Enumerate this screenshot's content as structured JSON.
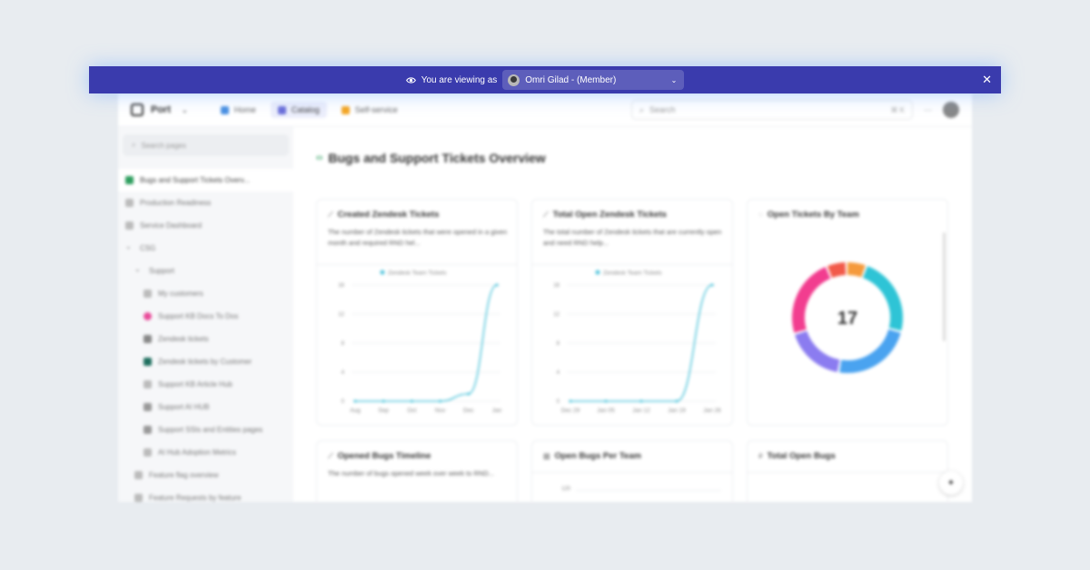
{
  "viewing_bar": {
    "label": "You are viewing as",
    "member": "Omri Gilad - (Member)"
  },
  "topnav": {
    "brand": "Port",
    "tabs": [
      {
        "label": "Home",
        "color": "#4a90e2"
      },
      {
        "label": "Catalog",
        "color": "#6b6fd9"
      },
      {
        "label": "Self-service",
        "color": "#f5a623"
      }
    ],
    "search_placeholder": "Search",
    "shortcut": "⌘ K",
    "more": "···"
  },
  "sidebar": {
    "search_placeholder": "Search pages",
    "items": [
      {
        "label": "Bugs and Support Tickets Overv...",
        "icon": "code-icon",
        "color": "#2e9e5e",
        "indent": 0,
        "active": true
      },
      {
        "label": "Production Readiness",
        "icon": "page-icon",
        "color": "#bbbbbb",
        "indent": 0
      },
      {
        "label": "Service Dashboard",
        "icon": "page-icon",
        "color": "#bbbbbb",
        "indent": 0
      },
      {
        "label": "CSG",
        "icon": "chevron-down-icon",
        "color": "",
        "indent": 0
      },
      {
        "label": "Support",
        "icon": "chevron-down-icon",
        "color": "",
        "indent": 1
      },
      {
        "label": "My customers",
        "icon": "page-icon",
        "color": "#bbbbbb",
        "indent": 2
      },
      {
        "label": "Support KB Docs To Dos",
        "icon": "circle-icon",
        "color": "#e94b9a",
        "indent": 2
      },
      {
        "label": "Zendesk tickets",
        "icon": "chat-icon",
        "color": "#888888",
        "indent": 2
      },
      {
        "label": "Zendesk tickets by Customer",
        "icon": "zendesk-icon",
        "color": "#1f6f5f",
        "indent": 2
      },
      {
        "label": "Support KB Article Hub",
        "icon": "page-icon",
        "color": "#bbbbbb",
        "indent": 2
      },
      {
        "label": "Support AI HUB",
        "icon": "ai-icon",
        "color": "#999999",
        "indent": 2
      },
      {
        "label": "Support SSIs and Entities pages",
        "icon": "gear-icon",
        "color": "#999999",
        "indent": 2
      },
      {
        "label": "AI Hub Adoption Metrics",
        "icon": "page-icon",
        "color": "#bbbbbb",
        "indent": 2
      },
      {
        "label": "Feature flag overview",
        "icon": "page-icon",
        "color": "#bbbbbb",
        "indent": 1
      },
      {
        "label": "Feature Requests by feature",
        "icon": "page-icon",
        "color": "#bbbbbb",
        "indent": 1
      }
    ]
  },
  "page_title": "Bugs and Support Tickets Overview",
  "widgets": {
    "created": {
      "title": "Created Zendesk Tickets",
      "desc": "The number of Zendesk tickets that were opened in a given month and required RND hel..."
    },
    "open": {
      "title": "Total Open Zendesk Tickets",
      "desc": "The total number of Zendesk tickets that are currently open and need RND help..."
    },
    "team": {
      "title": "Open Tickets By Team",
      "total": "17"
    },
    "bugs_timeline": {
      "title": "Opened Bugs Timeline",
      "desc": "The number of bugs opened week over week to RND..."
    },
    "bugs_team": {
      "title": "Open Bugs Per Team",
      "tick": "120"
    },
    "total_bugs": {
      "title": "Total Open Bugs"
    }
  },
  "chart_data": [
    {
      "type": "line",
      "title": "Created Zendesk Tickets",
      "series": [
        {
          "name": "Zendesk Team Tickets",
          "values": [
            0,
            0,
            0,
            0,
            1,
            16
          ]
        }
      ],
      "categories": [
        "Aug",
        "Sep",
        "Oct",
        "Nov",
        "Dec",
        "Jan"
      ],
      "yticks": [
        0,
        4,
        8,
        12,
        16
      ],
      "ylim": [
        0,
        16
      ],
      "color": "#5cc8dd"
    },
    {
      "type": "line",
      "title": "Total Open Zendesk Tickets",
      "series": [
        {
          "name": "Zendesk Team Tickets",
          "values": [
            0,
            0,
            0,
            0,
            16
          ]
        }
      ],
      "categories": [
        "Dec 29",
        "Jan 05",
        "Jan 12",
        "Jan 19",
        "Jan 26"
      ],
      "yticks": [
        0,
        4,
        8,
        12,
        16
      ],
      "ylim": [
        0,
        16
      ],
      "color": "#5cc8dd"
    },
    {
      "type": "pie",
      "title": "Open Tickets By Team",
      "total": 17,
      "slices": [
        {
          "label": "",
          "value": 4,
          "color": "#2ec4d6"
        },
        {
          "label": "",
          "value": 4,
          "color": "#4aa3f0"
        },
        {
          "label": "",
          "value": 3,
          "color": "#8b7cf0"
        },
        {
          "label": "",
          "value": 4,
          "color": "#f23d8f"
        },
        {
          "label": "",
          "value": 1,
          "color": "#f25a4a"
        },
        {
          "label": "",
          "value": 1,
          "color": "#f59a3c"
        }
      ]
    }
  ]
}
